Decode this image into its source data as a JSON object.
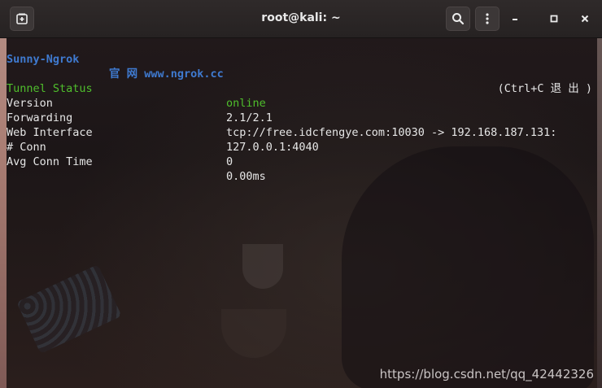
{
  "window": {
    "title": "root@kali: ~",
    "watermark": "https://blog.csdn.net/qq_42442326"
  },
  "titlebar": {
    "new_tab_icon": "new-tab-icon",
    "search_icon": "search-icon",
    "menu_icon": "kebab-menu-icon",
    "minimize_icon": "minimize-icon",
    "maximize_icon": "maximize-icon",
    "close_icon": "close-icon"
  },
  "header": {
    "name": "Sunny-Ngrok",
    "site": "官 网 www.ngrok.cc",
    "hint": "(Ctrl+C 退 出 )"
  },
  "status": [
    {
      "label": "Tunnel Status",
      "value": "online"
    },
    {
      "label": "Version",
      "value": "2.1/2.1"
    },
    {
      "label": "Forwarding",
      "value": "tcp://free.idcfengye.com:10030 -> 192.168.187.131:"
    },
    {
      "label": "Web Interface",
      "value": "127.0.0.1:4040"
    },
    {
      "label": "# Conn",
      "value": "0"
    },
    {
      "label": "Avg Conn Time",
      "value": "0.00ms"
    }
  ],
  "colors": {
    "header_blue": "#3f7ad0",
    "online_green": "#4fbf2c",
    "text": "#e6e6e6"
  }
}
